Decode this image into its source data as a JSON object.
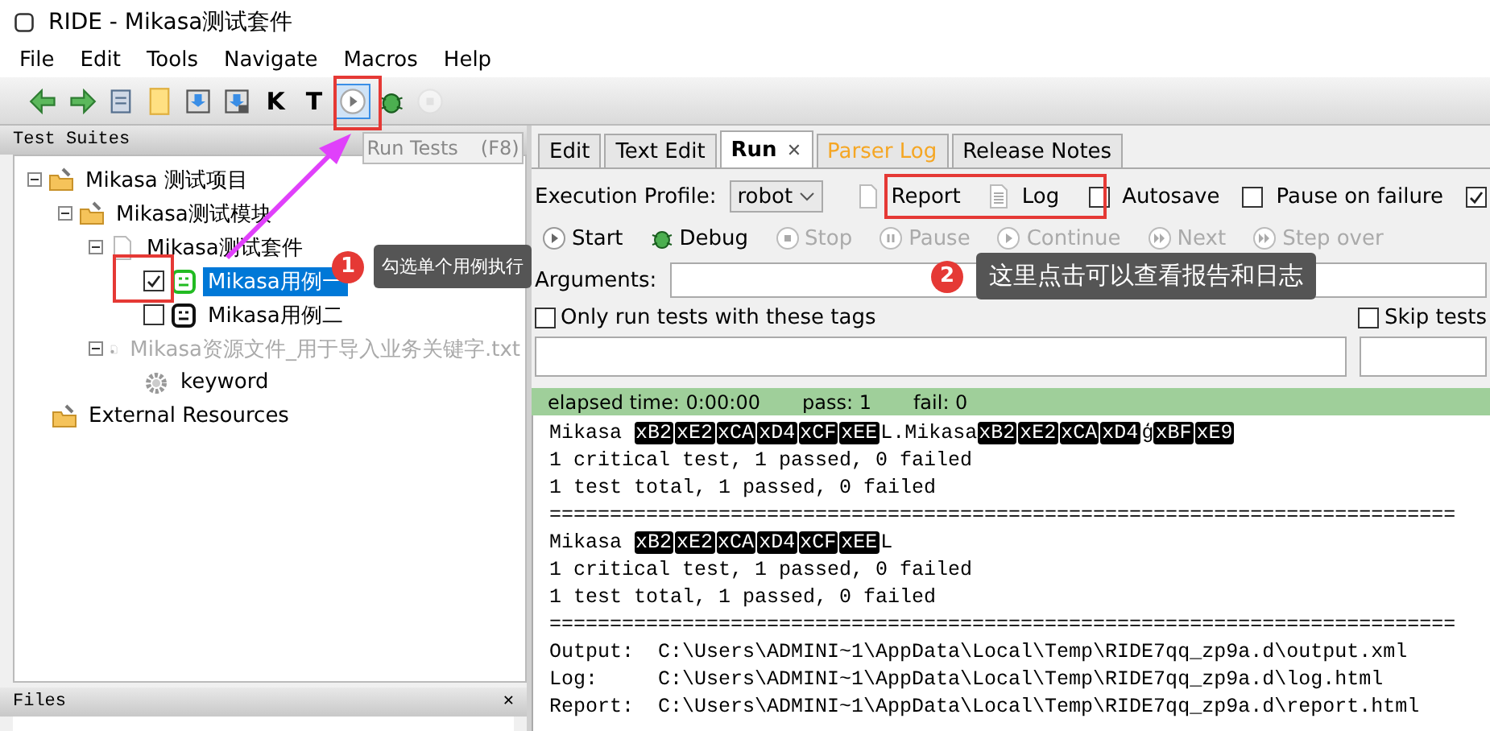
{
  "window": {
    "title": "RIDE - Mikasa测试套件"
  },
  "menu": [
    "File",
    "Edit",
    "Tools",
    "Navigate",
    "Macros",
    "Help"
  ],
  "toolbar": [
    {
      "kind": "back",
      "disabled": false
    },
    {
      "kind": "forward",
      "disabled": false
    },
    {
      "kind": "open",
      "disabled": false
    },
    {
      "kind": "folder",
      "disabled": false
    },
    {
      "kind": "save",
      "disabled": false
    },
    {
      "kind": "saveall",
      "disabled": false
    },
    {
      "kind": "letter",
      "label": "K",
      "disabled": false
    },
    {
      "kind": "letter",
      "label": "T",
      "disabled": false
    },
    {
      "kind": "run",
      "disabled": false,
      "highlighted": true
    },
    {
      "kind": "debug",
      "disabled": false
    },
    {
      "kind": "stop",
      "disabled": true
    }
  ],
  "tooltip": {
    "label": "Run Tests",
    "shortcut": "(F8)"
  },
  "test_suites": {
    "title": "Test Suites",
    "tree": [
      {
        "label": "Mikasa 测试项目",
        "kind": "folder",
        "expanded": true,
        "children": [
          {
            "label": "Mikasa测试模块",
            "kind": "folder",
            "expanded": true,
            "children": [
              {
                "label": "Mikasa测试套件",
                "kind": "suite",
                "expanded": true,
                "children": [
                  {
                    "label": "Mikasa用例一",
                    "kind": "test",
                    "checked": true,
                    "selected": true,
                    "passed": true
                  },
                  {
                    "label": "Mikasa用例二",
                    "kind": "test",
                    "checked": false,
                    "selected": false,
                    "passed": false
                  }
                ]
              },
              {
                "label": "Mikasa资源文件_用于导入业务关键字.txt",
                "kind": "resource",
                "expanded": true,
                "disabled": true,
                "children": [
                  {
                    "label": "keyword",
                    "kind": "keyword"
                  }
                ]
              }
            ]
          }
        ]
      },
      {
        "label": "External Resources",
        "kind": "folder"
      }
    ]
  },
  "files_panel": {
    "title": "Files",
    "close": "✕"
  },
  "tabs": [
    {
      "label": "Edit",
      "selected": false,
      "color": "#000000"
    },
    {
      "label": "Text Edit",
      "selected": false,
      "color": "#000000"
    },
    {
      "label": "Run",
      "selected": true,
      "color": "#000000",
      "close": "✕"
    },
    {
      "label": "Parser Log",
      "selected": false,
      "color": "#f5a623"
    },
    {
      "label": "Release Notes",
      "selected": false,
      "color": "#000000"
    }
  ],
  "run_panel": {
    "profile_label": "Execution Profile:",
    "profile": "robot",
    "report": "Report",
    "log": "Log",
    "options": [
      {
        "label": "Autosave",
        "checked": false
      },
      {
        "label": "Pause on failure",
        "checked": false
      },
      {
        "checked": true
      }
    ],
    "actions": [
      {
        "kind": "start",
        "label": "Start",
        "disabled": false
      },
      {
        "kind": "debug",
        "label": "Debug",
        "disabled": false
      },
      {
        "kind": "stop",
        "label": "Stop",
        "disabled": true
      },
      {
        "kind": "pause",
        "label": "Pause",
        "disabled": true
      },
      {
        "kind": "continue",
        "label": "Continue",
        "disabled": true
      },
      {
        "kind": "next",
        "label": "Next",
        "disabled": true
      },
      {
        "kind": "stepover",
        "label": "Step over",
        "disabled": true
      }
    ],
    "arguments_label": "Arguments:",
    "tag_filters": [
      {
        "label": "Only run tests with these tags",
        "checked": false
      },
      {
        "label": "Skip tests",
        "checked": false
      }
    ],
    "status": {
      "elapsed": "elapsed time: 0:00:00",
      "pass": "pass: 1",
      "fail": "fail: 0"
    },
    "output": [
      [
        {
          "kind": "text",
          "text": "Mikasa "
        },
        {
          "kind": "escape",
          "text": "xB2"
        },
        {
          "kind": "escape",
          "text": "xE2"
        },
        {
          "kind": "escape",
          "text": "xCA"
        },
        {
          "kind": "escape",
          "text": "xD4"
        },
        {
          "kind": "escape",
          "text": "xCF"
        },
        {
          "kind": "escape",
          "text": "xEE"
        },
        {
          "kind": "text",
          "text": "L.Mikasa"
        },
        {
          "kind": "escape",
          "text": "xB2"
        },
        {
          "kind": "escape",
          "text": "xE2"
        },
        {
          "kind": "escape",
          "text": "xCA"
        },
        {
          "kind": "escape",
          "text": "xD4"
        },
        {
          "kind": "text",
          "text": "ģ"
        },
        {
          "kind": "escape",
          "text": "xBF"
        },
        {
          "kind": "escape",
          "text": "xE9"
        }
      ],
      [
        {
          "kind": "text",
          "text": "1 critical test, 1 passed, 0 failed"
        }
      ],
      [
        {
          "kind": "text",
          "text": "1 test total, 1 passed, 0 failed"
        }
      ],
      [
        {
          "kind": "text",
          "text": "==========================================================================="
        }
      ],
      [
        {
          "kind": "text",
          "text": "Mikasa "
        },
        {
          "kind": "escape",
          "text": "xB2"
        },
        {
          "kind": "escape",
          "text": "xE2"
        },
        {
          "kind": "escape",
          "text": "xCA"
        },
        {
          "kind": "escape",
          "text": "xD4"
        },
        {
          "kind": "escape",
          "text": "xCF"
        },
        {
          "kind": "escape",
          "text": "xEE"
        },
        {
          "kind": "text",
          "text": "L"
        }
      ],
      [
        {
          "kind": "text",
          "text": "1 critical test, 1 passed, 0 failed"
        }
      ],
      [
        {
          "kind": "text",
          "text": "1 test total, 1 passed, 0 failed"
        }
      ],
      [
        {
          "kind": "text",
          "text": "==========================================================================="
        }
      ],
      [
        {
          "kind": "text",
          "text": "Output:  C:\\Users\\ADMINI~1\\AppData\\Local\\Temp\\RIDE7qq_zp9a.d\\output.xml"
        }
      ],
      [
        {
          "kind": "text",
          "text": "Log:     C:\\Users\\ADMINI~1\\AppData\\Local\\Temp\\RIDE7qq_zp9a.d\\log.html"
        }
      ],
      [
        {
          "kind": "text",
          "text": "Report:  C:\\Users\\ADMINI~1\\AppData\\Local\\Temp\\RIDE7qq_zp9a.d\\report.html"
        }
      ]
    ]
  },
  "callouts": [
    {
      "number": "1",
      "text": "勾选单个用例执行"
    },
    {
      "number": "2",
      "text": "这里点击可以查看报告和日志"
    }
  ]
}
